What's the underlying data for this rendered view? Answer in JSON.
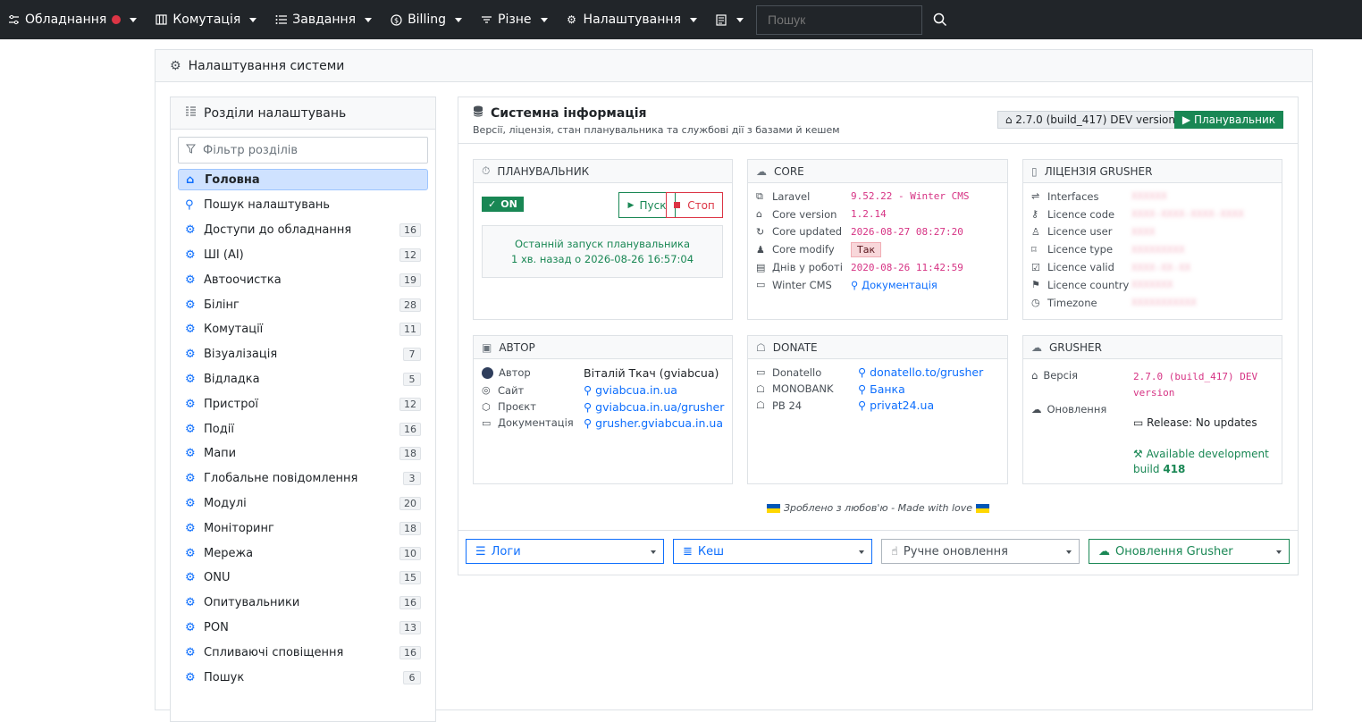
{
  "nav": {
    "equipment": "Обладнання",
    "switching": "Комутація",
    "tasks": "Завдання",
    "billing": "Billing",
    "misc": "Різне",
    "settings": "Налаштування",
    "search_placeholder": "Пошук"
  },
  "page": {
    "title": "Налаштування системи"
  },
  "sidebar": {
    "title": "Розділи налаштувань",
    "filter_placeholder": "Фільтр розділів",
    "items": [
      {
        "label": "Головна",
        "count": "",
        "icon": "home-icon"
      },
      {
        "label": "Пошук налаштувань",
        "count": "",
        "icon": "search-icon"
      },
      {
        "label": "Доступи до обладнання",
        "count": "16",
        "icon": "gear-icon"
      },
      {
        "label": "ШІ (AI)",
        "count": "12",
        "icon": "gear-icon"
      },
      {
        "label": "Автоочистка",
        "count": "19",
        "icon": "gear-icon"
      },
      {
        "label": "Білінг",
        "count": "28",
        "icon": "gear-icon"
      },
      {
        "label": "Комутації",
        "count": "11",
        "icon": "gear-icon"
      },
      {
        "label": "Візуалізація",
        "count": "7",
        "icon": "gear-icon"
      },
      {
        "label": "Відладка",
        "count": "5",
        "icon": "gear-icon"
      },
      {
        "label": "Пристрої",
        "count": "12",
        "icon": "gear-icon"
      },
      {
        "label": "Події",
        "count": "16",
        "icon": "gear-icon"
      },
      {
        "label": "Мапи",
        "count": "18",
        "icon": "gear-icon"
      },
      {
        "label": "Глобальне повідомлення",
        "count": "3",
        "icon": "gear-icon"
      },
      {
        "label": "Модулі",
        "count": "20",
        "icon": "gear-icon"
      },
      {
        "label": "Моніторинг",
        "count": "18",
        "icon": "gear-icon"
      },
      {
        "label": "Мережа",
        "count": "10",
        "icon": "gear-icon"
      },
      {
        "label": "ONU",
        "count": "15",
        "icon": "gear-icon"
      },
      {
        "label": "Опитувальники",
        "count": "16",
        "icon": "gear-icon"
      },
      {
        "label": "PON",
        "count": "13",
        "icon": "gear-icon"
      },
      {
        "label": "Спливаючі сповіщення",
        "count": "16",
        "icon": "gear-icon"
      },
      {
        "label": "Пошук",
        "count": "6",
        "icon": "gear-icon"
      }
    ]
  },
  "main": {
    "title": "Системна інформація",
    "subtitle": "Версії, ліцензія, стан планувальника та службові дії з базами й кешем",
    "version_badge": "2.7.0 (build_417) DEV version",
    "scheduler_badge": "Планувальник",
    "scheduler": {
      "title": "ПЛАНУВАЛЬНИК",
      "status": "ON",
      "start": "Пуск",
      "stop": "Стоп",
      "last_run_title": "Останній запуск планувальника",
      "last_run_value": "1 хв. назад о 2026-08-26 16:57:04"
    },
    "core": {
      "title": "CORE",
      "rows": [
        {
          "k": "Laravel",
          "v": "9.52.22 - Winter CMS"
        },
        {
          "k": "Core version",
          "v": "1.2.14"
        },
        {
          "k": "Core updated",
          "v": "2026-08-27 08:27:20"
        },
        {
          "k": "Core modify",
          "v": "Так"
        },
        {
          "k": "Днів у роботі",
          "v": "2020-08-26 11:42:59"
        },
        {
          "k": "Winter CMS",
          "v": "Документація"
        }
      ]
    },
    "license": {
      "title": "ЛІЦЕНЗІЯ GRUSHER",
      "rows": [
        {
          "k": "Interfaces",
          "v": "XXXXXX"
        },
        {
          "k": "Licence code",
          "v": "XXXX-XXXX-XXXX-XXXX"
        },
        {
          "k": "Licence user",
          "v": "XXXX"
        },
        {
          "k": "Licence type",
          "v": "XXXXXXXXX"
        },
        {
          "k": "Licence valid",
          "v": "XXXX-XX-XX"
        },
        {
          "k": "Licence country",
          "v": "XXXXXXX"
        },
        {
          "k": "Timezone",
          "v": "XXXXXXXXXXX"
        }
      ]
    },
    "author": {
      "title": "АВТОР",
      "rows": [
        {
          "k": "Автор",
          "v": "Віталій Ткач (gviabcua)"
        },
        {
          "k": "Сайт",
          "v": "gviabcua.in.ua"
        },
        {
          "k": "Проєкт",
          "v": "gviabcua.in.ua/grusher"
        },
        {
          "k": "Документація",
          "v": "grusher.gviabcua.in.ua"
        }
      ]
    },
    "donate": {
      "title": "DONATE",
      "rows": [
        {
          "k": "Donatello",
          "v": "donatello.to/grusher"
        },
        {
          "k": "MONOBANK",
          "v": "Банка"
        },
        {
          "k": "PB 24",
          "v": "privat24.ua"
        }
      ]
    },
    "grusher": {
      "title": "GRUSHER",
      "version_label": "Версія",
      "version_value": "2.7.0 (build_417) DEV version",
      "update_label": "Оновлення",
      "release": "Release: No updates",
      "dev_build": "Available development build",
      "dev_build_num": "418"
    },
    "love": "Зроблено з любов'ю - Made with love",
    "actions": {
      "logs": "Логи",
      "cache": "Кеш",
      "manual": "Ручне оновлення",
      "update": "Оновлення Grusher"
    }
  }
}
